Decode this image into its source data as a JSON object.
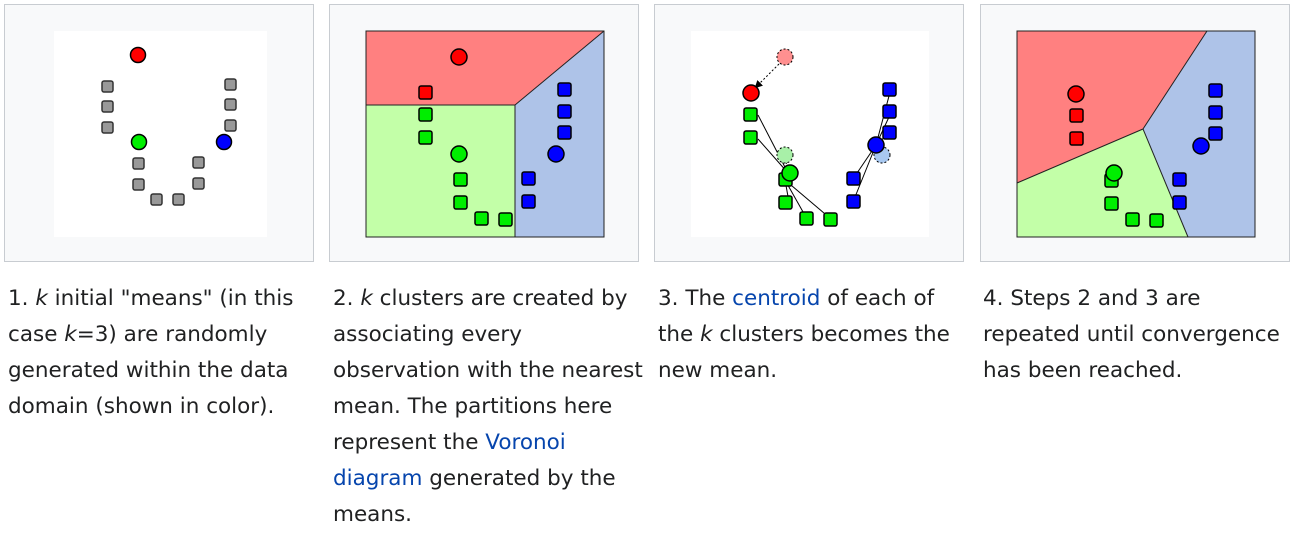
{
  "colors": {
    "red": "#ff0000",
    "green": "#00ee00",
    "blue": "#0000ff",
    "gray": "#999999",
    "red_region": "#ff8080",
    "green_region": "#c3ffa8",
    "blue_region": "#aec3e8",
    "link": "#0645ad"
  },
  "captions": [
    {
      "number": "1.",
      "k1": "k",
      "part1": " initial \"means\" (in this case ",
      "k2": "k",
      "part2": "=3) are randomly generated within the data domain (shown in color)."
    },
    {
      "number": "2.",
      "k1": "k",
      "part1": " clusters are created by associating every observation with the nearest mean. The partitions here represent the ",
      "link": "Voronoi diagram",
      "part2": " generated by the means."
    },
    {
      "number": "3.",
      "part0": " The ",
      "link": "centroid",
      "part1": " of each of the ",
      "k1": "k",
      "part2": " clusters becomes the new mean."
    },
    {
      "number": "4.",
      "part1": " Steps 2 and 3 are repeated until convergence has been reached."
    }
  ]
}
